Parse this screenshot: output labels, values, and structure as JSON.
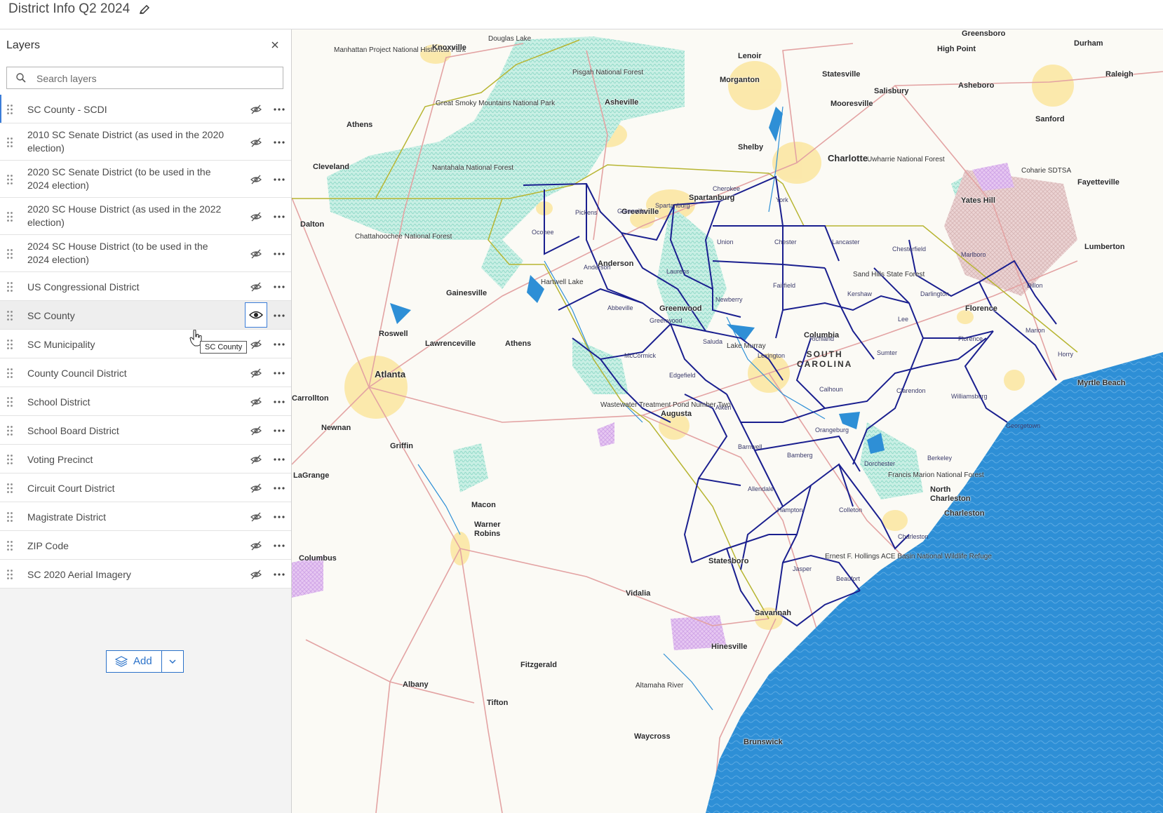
{
  "app": {
    "title": "District Info Q2 2024"
  },
  "panel": {
    "title": "Layers",
    "search_placeholder": "Search layers",
    "add_label": "Add"
  },
  "layers": [
    {
      "label": "SC County - SCDI",
      "visible": false
    },
    {
      "label": "2010 SC Senate District (as used in the 2020 election)",
      "visible": false
    },
    {
      "label": "2020 SC Senate District (to be used in the 2024 election)",
      "visible": false
    },
    {
      "label": "2020 SC House District (as used in the 2022 election)",
      "visible": false
    },
    {
      "label": "2024 SC House District (to be used in the 2024 election)",
      "visible": false
    },
    {
      "label": "US Congressional District",
      "visible": false
    },
    {
      "label": "SC County",
      "visible": true
    },
    {
      "label": "SC Municipality",
      "visible": false
    },
    {
      "label": "County Council District",
      "visible": false
    },
    {
      "label": "School District",
      "visible": false
    },
    {
      "label": "School Board District",
      "visible": false
    },
    {
      "label": "Voting Precinct",
      "visible": false
    },
    {
      "label": "Circuit Court District",
      "visible": false
    },
    {
      "label": "Magistrate District",
      "visible": false
    },
    {
      "label": "ZIP Code",
      "visible": false
    },
    {
      "label": "SC 2020 Aerial Imagery",
      "visible": false
    }
  ],
  "tooltip": "SC County",
  "map": {
    "cities": [
      "Knoxville",
      "Greensboro",
      "High Point",
      "Durham",
      "Raleigh",
      "Lenoir",
      "Statesville",
      "Morganton",
      "Salisbury",
      "Asheboro",
      "Asheville",
      "Mooresville",
      "Sanford",
      "Athens",
      "Shelby",
      "Charlotte",
      "Cleveland",
      "Fayetteville",
      "Spartanburg",
      "Yates Hill",
      "Dalton",
      "Lumberton",
      "Anderson",
      "Gainesville",
      "Greenwood",
      "Florence",
      "Roswell",
      "Lawrenceville",
      "Athens",
      "Columbia",
      "Atlanta",
      "Myrtle Beach",
      "Augusta",
      "Newnan",
      "Griffin",
      "LaGrange",
      "Macon",
      "Warner Robins",
      "North Charleston",
      "Charleston",
      "Columbus",
      "Statesboro",
      "Vidalia",
      "Savannah",
      "Hinesville",
      "Fitzgerald",
      "Albany",
      "Tifton",
      "Waycross",
      "Brunswick",
      "Greenville",
      "Carrollton"
    ],
    "counties": [
      "Pickens",
      "Oconee",
      "Cherokee",
      "York",
      "Union",
      "Chester",
      "Lancaster",
      "Chesterfield",
      "Marlboro",
      "Laurens",
      "Fairfield",
      "Abbeville",
      "Newberry",
      "Kershaw",
      "Darlington",
      "Dillon",
      "Lee",
      "Marion",
      "Saluda",
      "Lexington",
      "Richland",
      "Sumter",
      "Horry",
      "McCormick",
      "Edgefield",
      "Calhoun",
      "Clarendon",
      "Williamsburg",
      "Aiken",
      "Orangeburg",
      "Georgetown",
      "Barnwell",
      "Bamberg",
      "Dorchester",
      "Berkeley",
      "Allendale",
      "Hampton",
      "Colleton",
      "Charleston",
      "Jasper",
      "Beaufort",
      "Greenwood",
      "Spartanburg",
      "Greenville",
      "Anderson",
      "Florence"
    ],
    "parks": [
      "Manhattan Project National Historical Park",
      "Douglas Lake",
      "Pisgah National Forest",
      "Great Smoky Mountains National Park",
      "Nantahala National Forest",
      "Chattahoochee National Forest",
      "Uwharrie National Forest",
      "Coharie SDTSA",
      "Sand Hills State Forest",
      "Hartwell Lake",
      "Lake Murray",
      "Wastewater Treatment Pond Number Two",
      "Francis Marion National Forest",
      "Ernest F. Hollings ACE Basin National Wildlife Refuge",
      "Altamaha River"
    ],
    "state_label": "SOUTH CAROLINA",
    "state_label_line1": "SOUTH",
    "state_label_line2": "CAROLINA",
    "colors": {
      "water": "#2e8fd6",
      "forest": "#a7e3d6",
      "county_line": "#1a1f8f",
      "state_line": "#b7b532",
      "road": "#e3a3a3",
      "urban": "#fbe7a4"
    }
  }
}
